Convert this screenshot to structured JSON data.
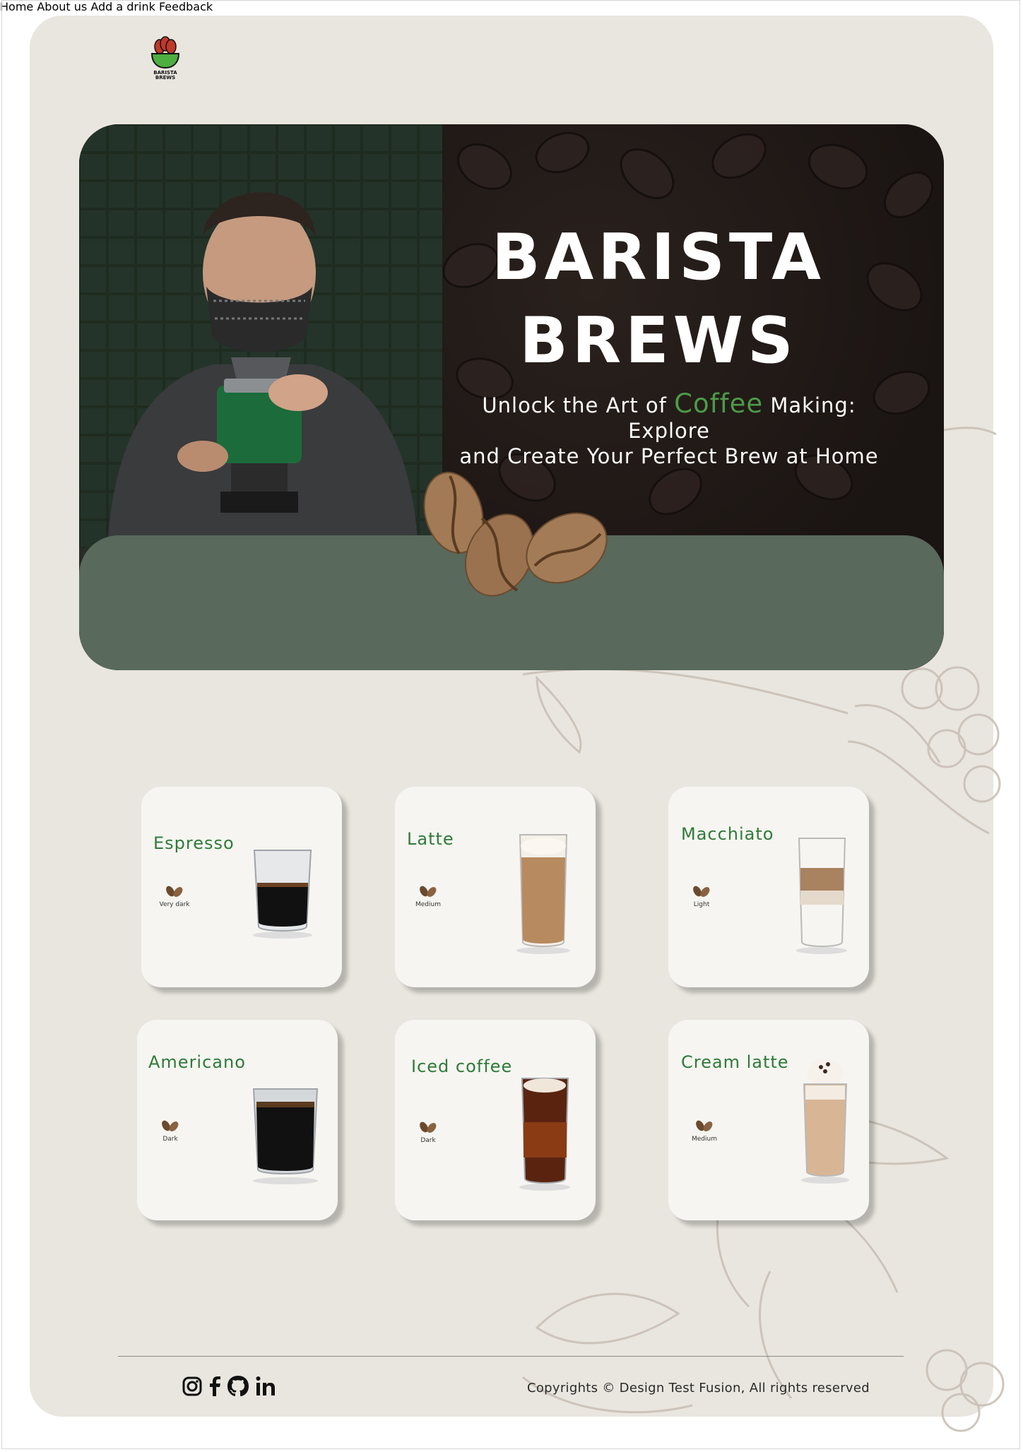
{
  "brand": {
    "logo_text_line1": "BARISTA",
    "logo_text_line2": "BREWS",
    "accent_color": "#3a7a3d"
  },
  "nav": {
    "items": [
      "Home",
      "About us",
      "Add a drink",
      "Feedback"
    ]
  },
  "hero": {
    "title_line1": "BARISTA",
    "title_line2": "BREWS",
    "subtitle_pre": "Unlock the Art of ",
    "subtitle_accent": "Coffee",
    "subtitle_post": " Making: Explore",
    "subtitle_line2": "and Create Your Perfect Brew at Home"
  },
  "drinks": [
    {
      "name": "Espresso",
      "roast": "Very dark"
    },
    {
      "name": "Latte",
      "roast": "Medium"
    },
    {
      "name": "Macchiato",
      "roast": "Light"
    },
    {
      "name": "Americano",
      "roast": "Dark"
    },
    {
      "name": "Iced coffee",
      "roast": "Dark"
    },
    {
      "name": "Cream latte",
      "roast": "Medium"
    }
  ],
  "footer": {
    "social_icons": [
      "instagram-icon",
      "facebook-icon",
      "github-icon",
      "linkedin-icon"
    ],
    "copyright": "Copyrights © Design Test Fusion, All rights reserved"
  }
}
